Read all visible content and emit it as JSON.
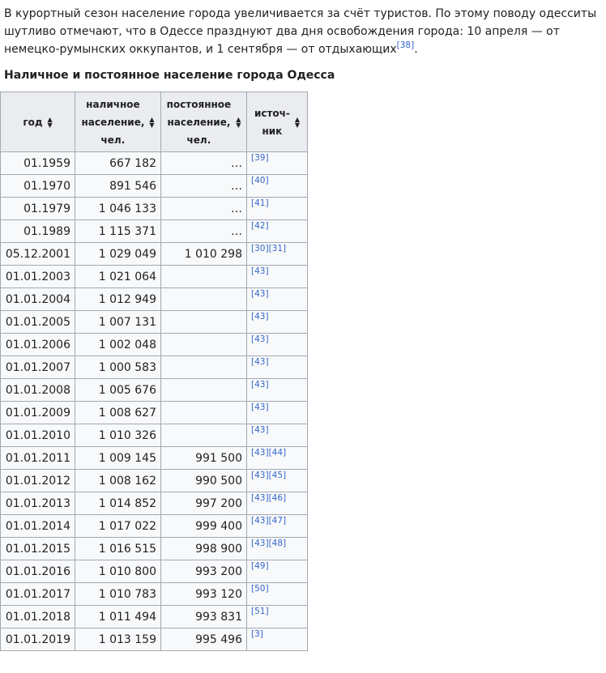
{
  "intro": {
    "text": "В курортный сезон население города увеличивается за счёт туристов. По этому поводу одесситы шутливо отмечают, что в Одессе празднуют два дня освобождения города: 10 апреля — от немецко-румынских оккупантов, и 1 сентября — от отдыхающих",
    "ref": "[38]",
    "end": "."
  },
  "table": {
    "caption": "Наличное и постоянное население города Одесса",
    "headers": [
      {
        "line1": "год",
        "line2": "",
        "line3": ""
      },
      {
        "line1": "наличное",
        "line2": "население,",
        "line3": "чел."
      },
      {
        "line1": "постоянное",
        "line2": "население,",
        "line3": "чел."
      },
      {
        "line1": "источ-",
        "line2": "ник",
        "line3": ""
      }
    ],
    "rows": [
      {
        "year": "01.1959",
        "present": "667 182",
        "permanent": "…",
        "refs": [
          "[39]"
        ]
      },
      {
        "year": "01.1970",
        "present": "891 546",
        "permanent": "…",
        "refs": [
          "[40]"
        ]
      },
      {
        "year": "01.1979",
        "present": "1 046 133",
        "permanent": "…",
        "refs": [
          "[41]"
        ]
      },
      {
        "year": "01.1989",
        "present": "1 115 371",
        "permanent": "…",
        "refs": [
          "[42]"
        ]
      },
      {
        "year": "05.12.2001",
        "present": "1 029 049",
        "permanent": "1 010 298",
        "refs": [
          "[30]",
          "[31]"
        ]
      },
      {
        "year": "01.01.2003",
        "present": "1 021 064",
        "permanent": "",
        "refs": [
          "[43]"
        ]
      },
      {
        "year": "01.01.2004",
        "present": "1 012 949",
        "permanent": "",
        "refs": [
          "[43]"
        ]
      },
      {
        "year": "01.01.2005",
        "present": "1 007 131",
        "permanent": "",
        "refs": [
          "[43]"
        ]
      },
      {
        "year": "01.01.2006",
        "present": "1 002 048",
        "permanent": "",
        "refs": [
          "[43]"
        ]
      },
      {
        "year": "01.01.2007",
        "present": "1 000 583",
        "permanent": "",
        "refs": [
          "[43]"
        ]
      },
      {
        "year": "01.01.2008",
        "present": "1 005 676",
        "permanent": "",
        "refs": [
          "[43]"
        ]
      },
      {
        "year": "01.01.2009",
        "present": "1 008 627",
        "permanent": "",
        "refs": [
          "[43]"
        ]
      },
      {
        "year": "01.01.2010",
        "present": "1 010 326",
        "permanent": "",
        "refs": [
          "[43]"
        ]
      },
      {
        "year": "01.01.2011",
        "present": "1 009 145",
        "permanent": "991 500",
        "refs": [
          "[43]",
          "[44]"
        ]
      },
      {
        "year": "01.01.2012",
        "present": "1 008 162",
        "permanent": "990 500",
        "refs": [
          "[43]",
          "[45]"
        ]
      },
      {
        "year": "01.01.2013",
        "present": "1 014 852",
        "permanent": "997 200",
        "refs": [
          "[43]",
          "[46]"
        ]
      },
      {
        "year": "01.01.2014",
        "present": "1 017 022",
        "permanent": "999 400",
        "refs": [
          "[43]",
          "[47]"
        ]
      },
      {
        "year": "01.01.2015",
        "present": "1 016 515",
        "permanent": "998 900",
        "refs": [
          "[43]",
          "[48]"
        ]
      },
      {
        "year": "01.01.2016",
        "present": "1 010 800",
        "permanent": "993 200",
        "refs": [
          "[49]"
        ]
      },
      {
        "year": "01.01.2017",
        "present": "1 010 783",
        "permanent": "993 120",
        "refs": [
          "[50]"
        ]
      },
      {
        "year": "01.01.2018",
        "present": "1 011 494",
        "permanent": "993 831",
        "refs": [
          "[51]"
        ]
      },
      {
        "year": "01.01.2019",
        "present": "1 013 159",
        "permanent": "995 496",
        "refs": [
          "[3]"
        ]
      }
    ]
  },
  "icons": {
    "sort": "sort-arrows-icon"
  },
  "colors": {
    "link": "#3366cc",
    "header_bg": "#eaecf0",
    "cell_bg": "#f8f9fa",
    "border": "#a2a9b1",
    "text": "#202122"
  }
}
